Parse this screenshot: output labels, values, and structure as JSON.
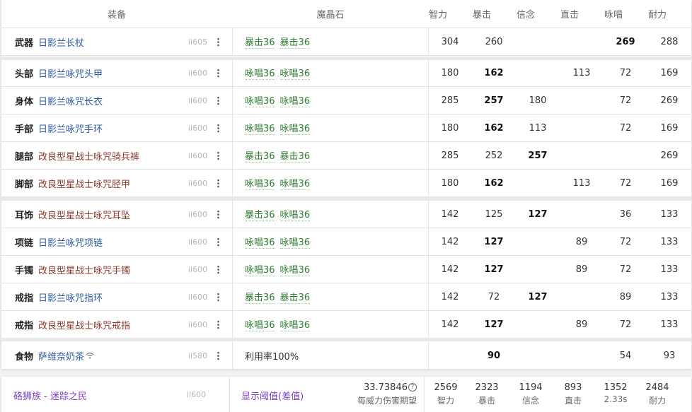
{
  "header": {
    "gear": "装备",
    "materia": "魔晶石",
    "stats": [
      "智力",
      "暴击",
      "信念",
      "直击",
      "咏唱",
      "耐力"
    ]
  },
  "rows": [
    {
      "slot": "武器",
      "name": "日影兰长杖",
      "color": "blue",
      "il": "il605",
      "melds": [
        "暴击36",
        "暴击36"
      ],
      "stats": [
        "304",
        "260",
        "",
        "",
        "269",
        "288"
      ],
      "bold": [
        false,
        false,
        false,
        false,
        true,
        false
      ]
    },
    {
      "slot": "头部",
      "name": "日影兰咏咒头甲",
      "color": "blue",
      "il": "il600",
      "melds": [
        "咏唱36",
        "咏唱36"
      ],
      "stats": [
        "180",
        "162",
        "",
        "113",
        "72",
        "169"
      ],
      "bold": [
        false,
        true,
        false,
        false,
        false,
        false
      ]
    },
    {
      "slot": "身体",
      "name": "日影兰咏咒长衣",
      "color": "blue",
      "il": "il600",
      "melds": [
        "咏唱36",
        "咏唱36"
      ],
      "stats": [
        "285",
        "257",
        "180",
        "",
        "72",
        "269"
      ],
      "bold": [
        false,
        true,
        false,
        false,
        false,
        false
      ]
    },
    {
      "slot": "手部",
      "name": "日影兰咏咒手环",
      "color": "blue",
      "il": "il600",
      "melds": [
        "咏唱36",
        "咏唱36"
      ],
      "stats": [
        "180",
        "162",
        "113",
        "",
        "72",
        "169"
      ],
      "bold": [
        false,
        true,
        false,
        false,
        false,
        false
      ]
    },
    {
      "slot": "腿部",
      "name": "改良型星战士咏咒骑兵裤",
      "color": "brown",
      "il": "il600",
      "melds": [
        "暴击36",
        "暴击36"
      ],
      "stats": [
        "285",
        "252",
        "257",
        "",
        "",
        "269"
      ],
      "bold": [
        false,
        false,
        true,
        false,
        false,
        false
      ]
    },
    {
      "slot": "脚部",
      "name": "改良型星战士咏咒胫甲",
      "color": "brown",
      "il": "il600",
      "melds": [
        "咏唱36",
        "咏唱36"
      ],
      "stats": [
        "180",
        "162",
        "",
        "113",
        "72",
        "169"
      ],
      "bold": [
        false,
        true,
        false,
        false,
        false,
        false
      ]
    },
    {
      "slot": "耳饰",
      "name": "改良型星战士咏咒耳坠",
      "color": "brown",
      "il": "il600",
      "melds": [
        "暴击36",
        "咏唱36"
      ],
      "stats": [
        "142",
        "125",
        "127",
        "",
        "36",
        "133"
      ],
      "bold": [
        false,
        false,
        true,
        false,
        false,
        false
      ]
    },
    {
      "slot": "项链",
      "name": "日影兰咏咒项链",
      "color": "blue",
      "il": "il600",
      "melds": [
        "咏唱36",
        "咏唱36"
      ],
      "stats": [
        "142",
        "127",
        "",
        "89",
        "72",
        "133"
      ],
      "bold": [
        false,
        true,
        false,
        false,
        false,
        false
      ]
    },
    {
      "slot": "手镯",
      "name": "改良型星战士咏咒手镯",
      "color": "brown",
      "il": "il600",
      "melds": [
        "咏唱36",
        "咏唱36"
      ],
      "stats": [
        "142",
        "127",
        "",
        "89",
        "72",
        "133"
      ],
      "bold": [
        false,
        true,
        false,
        false,
        false,
        false
      ]
    },
    {
      "slot": "戒指",
      "name": "日影兰咏咒指环",
      "color": "blue",
      "il": "il600",
      "melds": [
        "暴击36",
        "暴击36"
      ],
      "stats": [
        "142",
        "72",
        "127",
        "",
        "89",
        "133"
      ],
      "bold": [
        false,
        false,
        true,
        false,
        false,
        false
      ]
    },
    {
      "slot": "戒指",
      "name": "改良型星战士咏咒戒指",
      "color": "brown",
      "il": "il600",
      "melds": [
        "咏唱36",
        "咏唱36"
      ],
      "stats": [
        "142",
        "127",
        "",
        "89",
        "72",
        "133"
      ],
      "bold": [
        false,
        true,
        false,
        false,
        false,
        false
      ]
    }
  ],
  "food": {
    "slot": "食物",
    "name": "萨维奈奶茶",
    "il": "il580",
    "note": "利用率100%",
    "stats": [
      "",
      "90",
      "",
      "",
      "54",
      "93"
    ],
    "bold": [
      false,
      true,
      false,
      false,
      false,
      false
    ]
  },
  "footer": {
    "job": "硌狮族 - 迷踪之民",
    "il": "il600",
    "threshold": "显示阈值(差值)",
    "damage_value": "33.73846",
    "damage_label": "每威力伤害期望",
    "stats": [
      {
        "value": "2569",
        "label": "智力"
      },
      {
        "value": "2323",
        "label": "暴击"
      },
      {
        "value": "1194",
        "label": "信念"
      },
      {
        "value": "893",
        "label": "直击"
      },
      {
        "value": "1352",
        "label": "2.33s"
      },
      {
        "value": "2484",
        "label": "耐力"
      }
    ]
  },
  "colors": {
    "blue_item": "#2d5aa0",
    "brown_item": "#8a3a2c",
    "meld": "#2e7d32",
    "footer_link": "#7b3fbf"
  }
}
